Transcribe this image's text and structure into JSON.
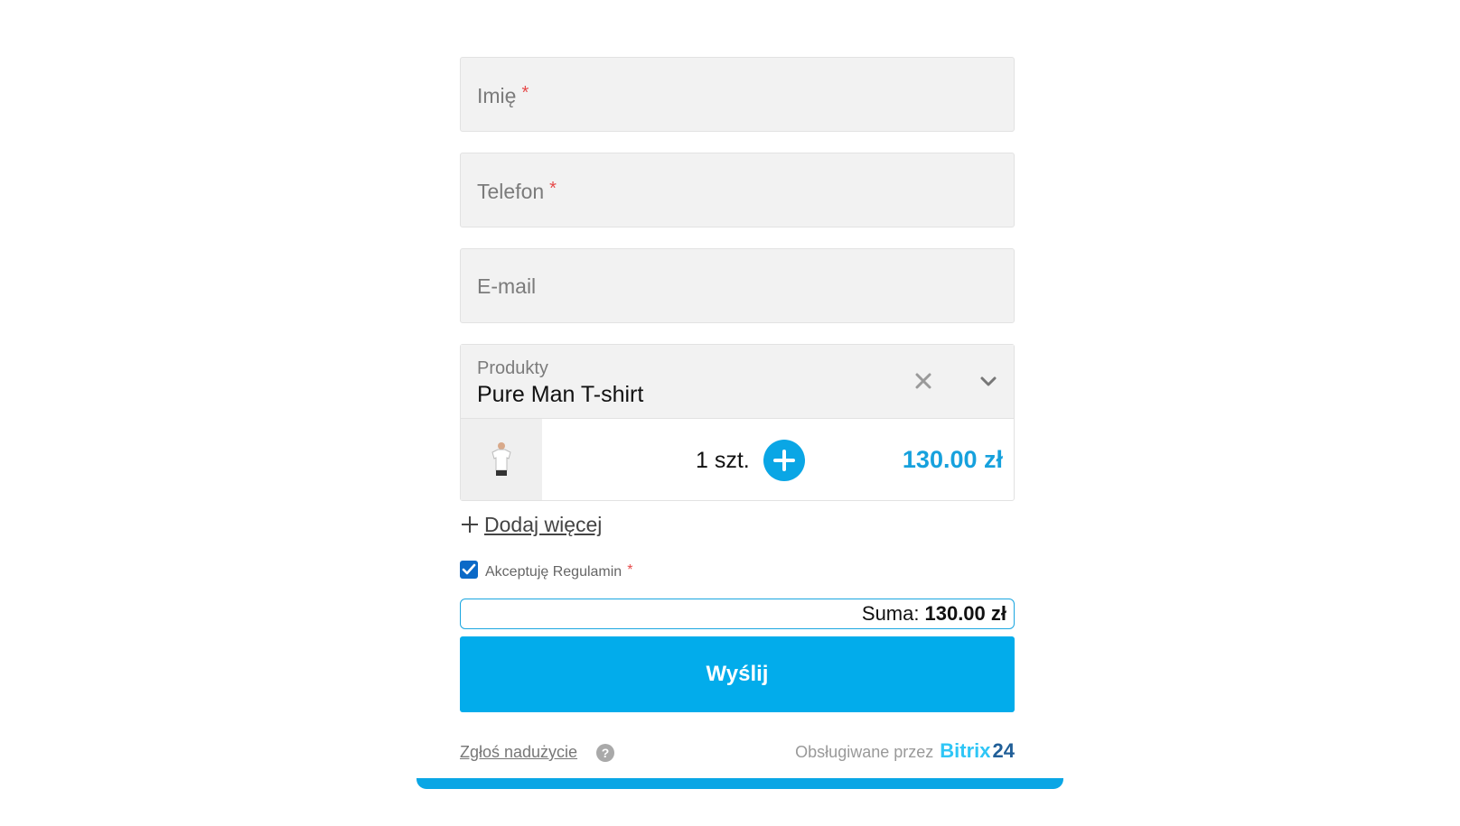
{
  "fields": [
    {
      "placeholder": "Imię",
      "required": "*"
    },
    {
      "placeholder": "Telefon",
      "required": "*"
    },
    {
      "placeholder": "E-mail",
      "required": ""
    }
  ],
  "products": {
    "label": "Produkty",
    "selected": "Pure Man T-shirt",
    "item": {
      "quantity": "1 szt.",
      "price": "130.00 zł"
    },
    "add_more": "Dodaj więcej"
  },
  "terms": {
    "label": "Akceptuję Regulamin",
    "required": "*",
    "checked": true
  },
  "summary": {
    "label": "Suma:",
    "value": "130.00 zł"
  },
  "submit_label": "Wyślij",
  "footer": {
    "report": "Zgłoś nadużycie",
    "help": "?",
    "powered_by": "Obsługiwane przez",
    "brand_part1": "Bitrix",
    "brand_part2": "24"
  },
  "colors": {
    "accent": "#02aceb",
    "price": "#16a1dd",
    "required": "#e64a4a",
    "brand_light": "#2fc6f6",
    "brand_dark": "#215f98"
  },
  "icons": {
    "clear": "close-icon",
    "dropdown": "chevron-down-icon",
    "increase": "plus-circle-icon",
    "add_more": "plus-icon",
    "help": "help-icon",
    "product": "tshirt-thumbnail"
  }
}
